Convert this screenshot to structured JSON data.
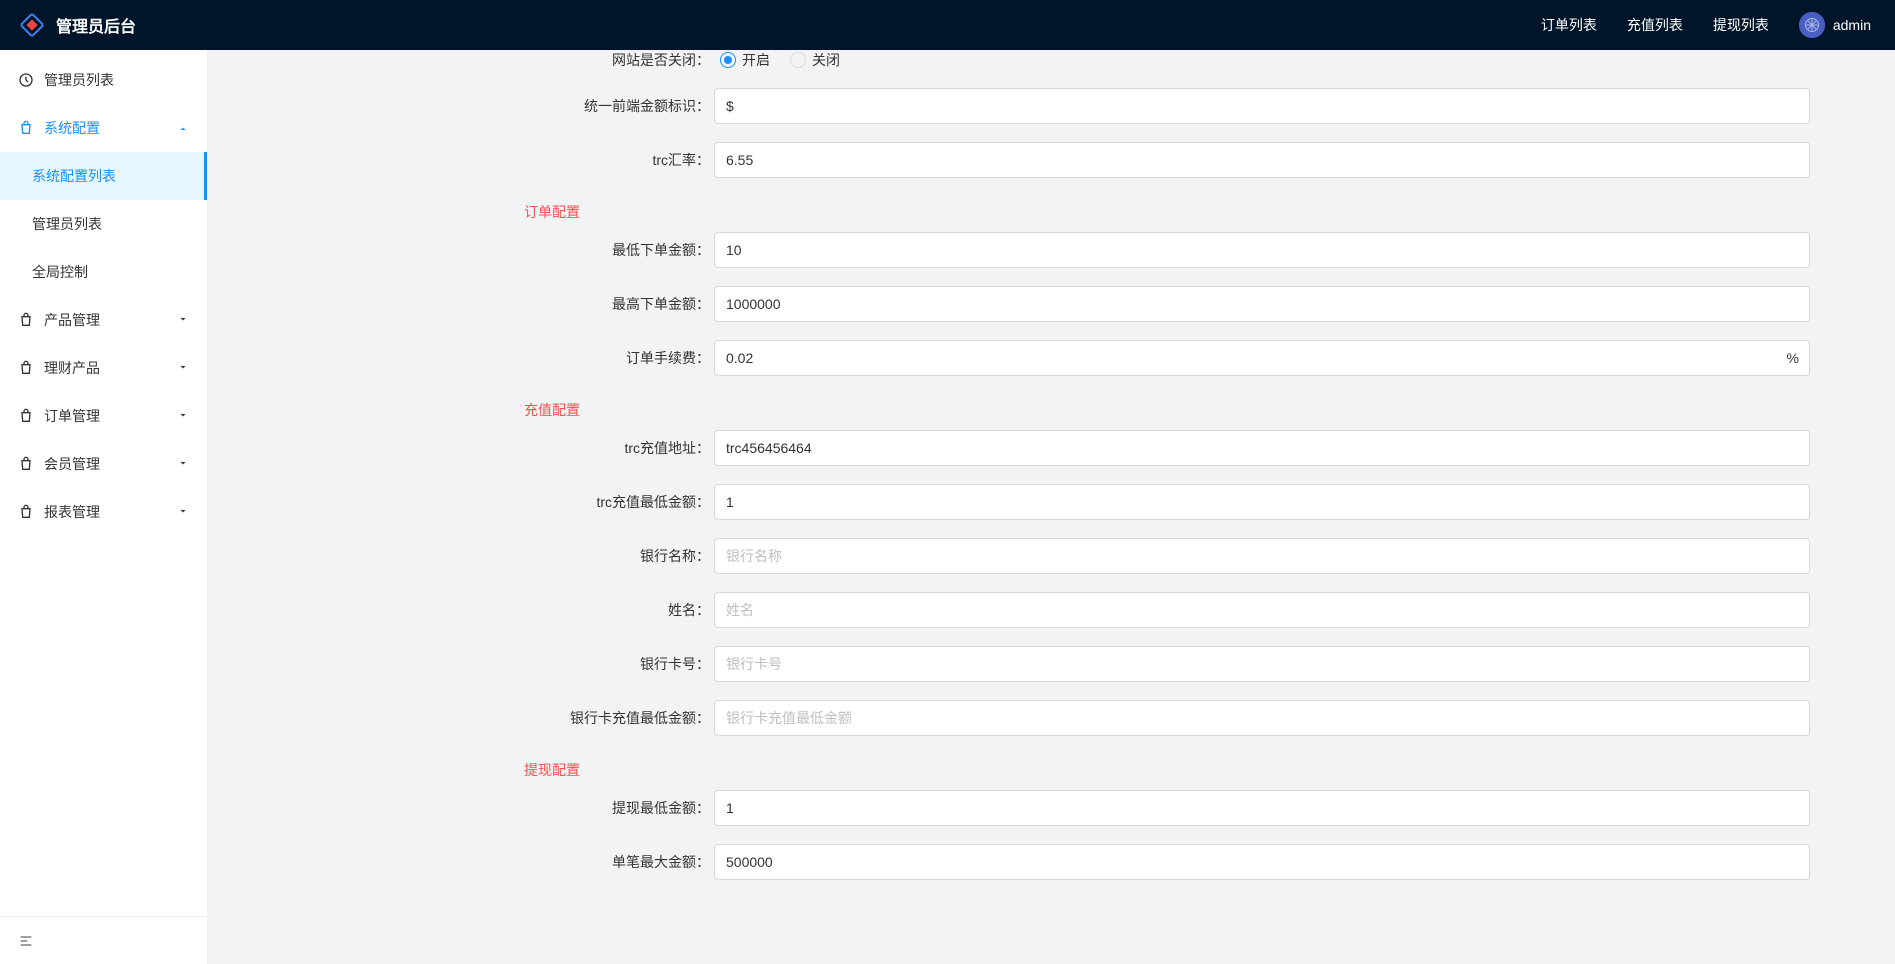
{
  "header": {
    "title": "管理员后台",
    "nav": {
      "orders": "订单列表",
      "recharge": "充值列表",
      "withdraw": "提现列表"
    },
    "user": "admin"
  },
  "sidebar": {
    "items": [
      {
        "label": "管理员列表",
        "icon": "clock"
      },
      {
        "label": "系统配置",
        "icon": "bag",
        "open": true,
        "children": [
          {
            "label": "系统配置列表",
            "active": true
          },
          {
            "label": "管理员列表"
          },
          {
            "label": "全局控制"
          }
        ]
      },
      {
        "label": "产品管理",
        "icon": "bag"
      },
      {
        "label": "理财产品",
        "icon": "bag"
      },
      {
        "label": "订单管理",
        "icon": "bag"
      },
      {
        "label": "会员管理",
        "icon": "bag"
      },
      {
        "label": "报表管理",
        "icon": "bag"
      }
    ]
  },
  "form": {
    "site_closed_label": "网站是否关闭",
    "site_closed_open": "开启",
    "site_closed_close": "关闭",
    "currency_symbol_label": "统一前端金额标识",
    "currency_symbol": "$",
    "trc_rate_label": "trc汇率",
    "trc_rate": "6.55",
    "order_section": "订单配置",
    "order_min_label": "最低下单金额",
    "order_min": "10",
    "order_max_label": "最高下单金额",
    "order_max": "1000000",
    "order_fee_label": "订单手续费",
    "order_fee": "0.02",
    "order_fee_suffix": "%",
    "recharge_section": "充值配置",
    "trc_addr_label": "trc充值地址",
    "trc_addr": "trc456456464",
    "trc_min_label": "trc充值最低金额",
    "trc_min": "1",
    "bank_name_label": "银行名称",
    "bank_name_ph": "银行名称",
    "name_label": "姓名",
    "name_ph": "姓名",
    "card_label": "银行卡号",
    "card_ph": "银行卡号",
    "card_min_label": "银行卡充值最低金额",
    "card_min_ph": "银行卡充值最低金额",
    "withdraw_section": "提现配置",
    "withdraw_min_label": "提现最低金额",
    "withdraw_min": "1",
    "single_max_label": "单笔最大金额",
    "single_max": "500000"
  }
}
